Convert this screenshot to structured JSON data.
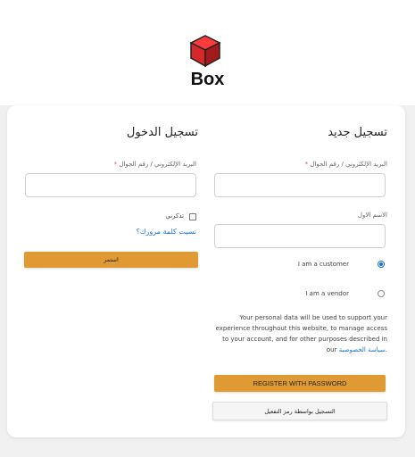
{
  "brand": {
    "name": "Box",
    "cube_color": "#d62828"
  },
  "register": {
    "title": "تسجيل جديد",
    "email_label": "البريد الإلكتروني / رقم الجوال",
    "email_value": "",
    "firstname_label": "الاسم الاول",
    "firstname_value": "",
    "role_options": [
      {
        "label": "I am a customer",
        "selected": true
      },
      {
        "label": "I am a vendor",
        "selected": false
      }
    ],
    "privacy_text": "Your personal data will be used to support your experience throughout this website, to manage access to your account, and for other purposes described in our",
    "privacy_link": "سياسة الخصوصية",
    "privacy_end": ".",
    "submit_label": "REGISTER WITH PASSWORD",
    "otp_label": "التسجيل بواسطة رمز التفعيل"
  },
  "login": {
    "title": "تسجيل الدخول",
    "email_label": "البريد الإلكتروني / رقم الجوال",
    "email_value": "",
    "remember_label": "تذكرني",
    "remember_checked": false,
    "forgot_label": "نسيت كلمة مرورك؟",
    "submit_label": "استمر"
  },
  "required_mark": "*",
  "colors": {
    "accent": "#e09a33",
    "link": "#1e6fd9",
    "required": "#d9534f"
  }
}
